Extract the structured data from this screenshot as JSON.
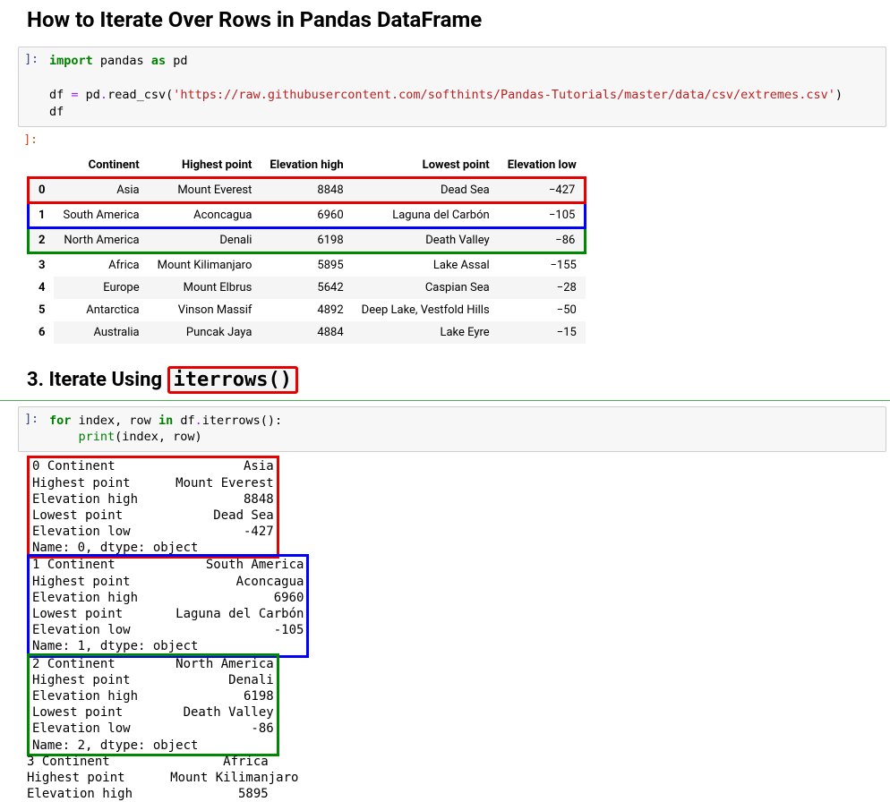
{
  "title": "How to Iterate Over Rows in Pandas DataFrame",
  "cell1": {
    "line1_kw1": "import",
    "line1_ident": " pandas ",
    "line1_kw2": "as",
    "line1_alias": " pd",
    "line3_a": "df ",
    "line3_eq": "= ",
    "line3_b": "pd",
    "line3_dot1": ".",
    "line3_c": "read_csv(",
    "line3_str": "'https://raw.githubusercontent.com/softhints/Pandas-Tutorials/master/data/csv/extremes.csv'",
    "line3_close": ")",
    "line4": "df"
  },
  "table": {
    "headers": [
      "",
      "Continent",
      "Highest point",
      "Elevation high",
      "Lowest point",
      "Elevation low"
    ],
    "rows": [
      {
        "idx": "0",
        "c": [
          "Asia",
          "Mount Everest",
          "8848",
          "Dead Sea",
          "−427"
        ],
        "box": "red"
      },
      {
        "idx": "1",
        "c": [
          "South America",
          "Aconcagua",
          "6960",
          "Laguna del Carbón",
          "−105"
        ],
        "box": "blue"
      },
      {
        "idx": "2",
        "c": [
          "North America",
          "Denali",
          "6198",
          "Death Valley",
          "−86"
        ],
        "box": "green"
      },
      {
        "idx": "3",
        "c": [
          "Africa",
          "Mount Kilimanjaro",
          "5895",
          "Lake Assal",
          "−155"
        ],
        "box": ""
      },
      {
        "idx": "4",
        "c": [
          "Europe",
          "Mount Elbrus",
          "5642",
          "Caspian Sea",
          "−28"
        ],
        "box": ""
      },
      {
        "idx": "5",
        "c": [
          "Antarctica",
          "Vinson Massif",
          "4892",
          "Deep Lake, Vestfold Hills",
          "−50"
        ],
        "box": ""
      },
      {
        "idx": "6",
        "c": [
          "Australia",
          "Puncak Jaya",
          "4884",
          "Lake Eyre",
          "−15"
        ],
        "box": ""
      }
    ]
  },
  "section3_prefix": "3. Iterate Using ",
  "section3_code": "iterrows()",
  "cell2": {
    "l1_for": "for",
    "l1_a": " index, row ",
    "l1_in": "in",
    "l1_b": " df",
    "l1_dot": ".",
    "l1_c": "iterrows():",
    "l2_indent": "    ",
    "l2_print": "print",
    "l2_args": "(index, row)"
  },
  "output_blocks": [
    {
      "box": "red",
      "text": "0 Continent                 Asia\nHighest point      Mount Everest\nElevation high              8848\nLowest point            Dead Sea\nElevation low               -427\nName: 0, dtype: object"
    },
    {
      "box": "blue",
      "text": "1 Continent            South America\nHighest point              Aconcagua\nElevation high                  6960\nLowest point       Laguna del Carbón\nElevation low                   -105\nName: 1, dtype: object"
    },
    {
      "box": "green",
      "text": "2 Continent        North America\nHighest point             Denali\nElevation high              6198\nLowest point        Death Valley\nElevation low                -86\nName: 2, dtype: object"
    },
    {
      "box": "",
      "text": "3 Continent               Africa\nHighest point      Mount Kilimanjaro\nElevation high              5895"
    }
  ],
  "prompt_in": "]:",
  "prompt_out": "]:"
}
